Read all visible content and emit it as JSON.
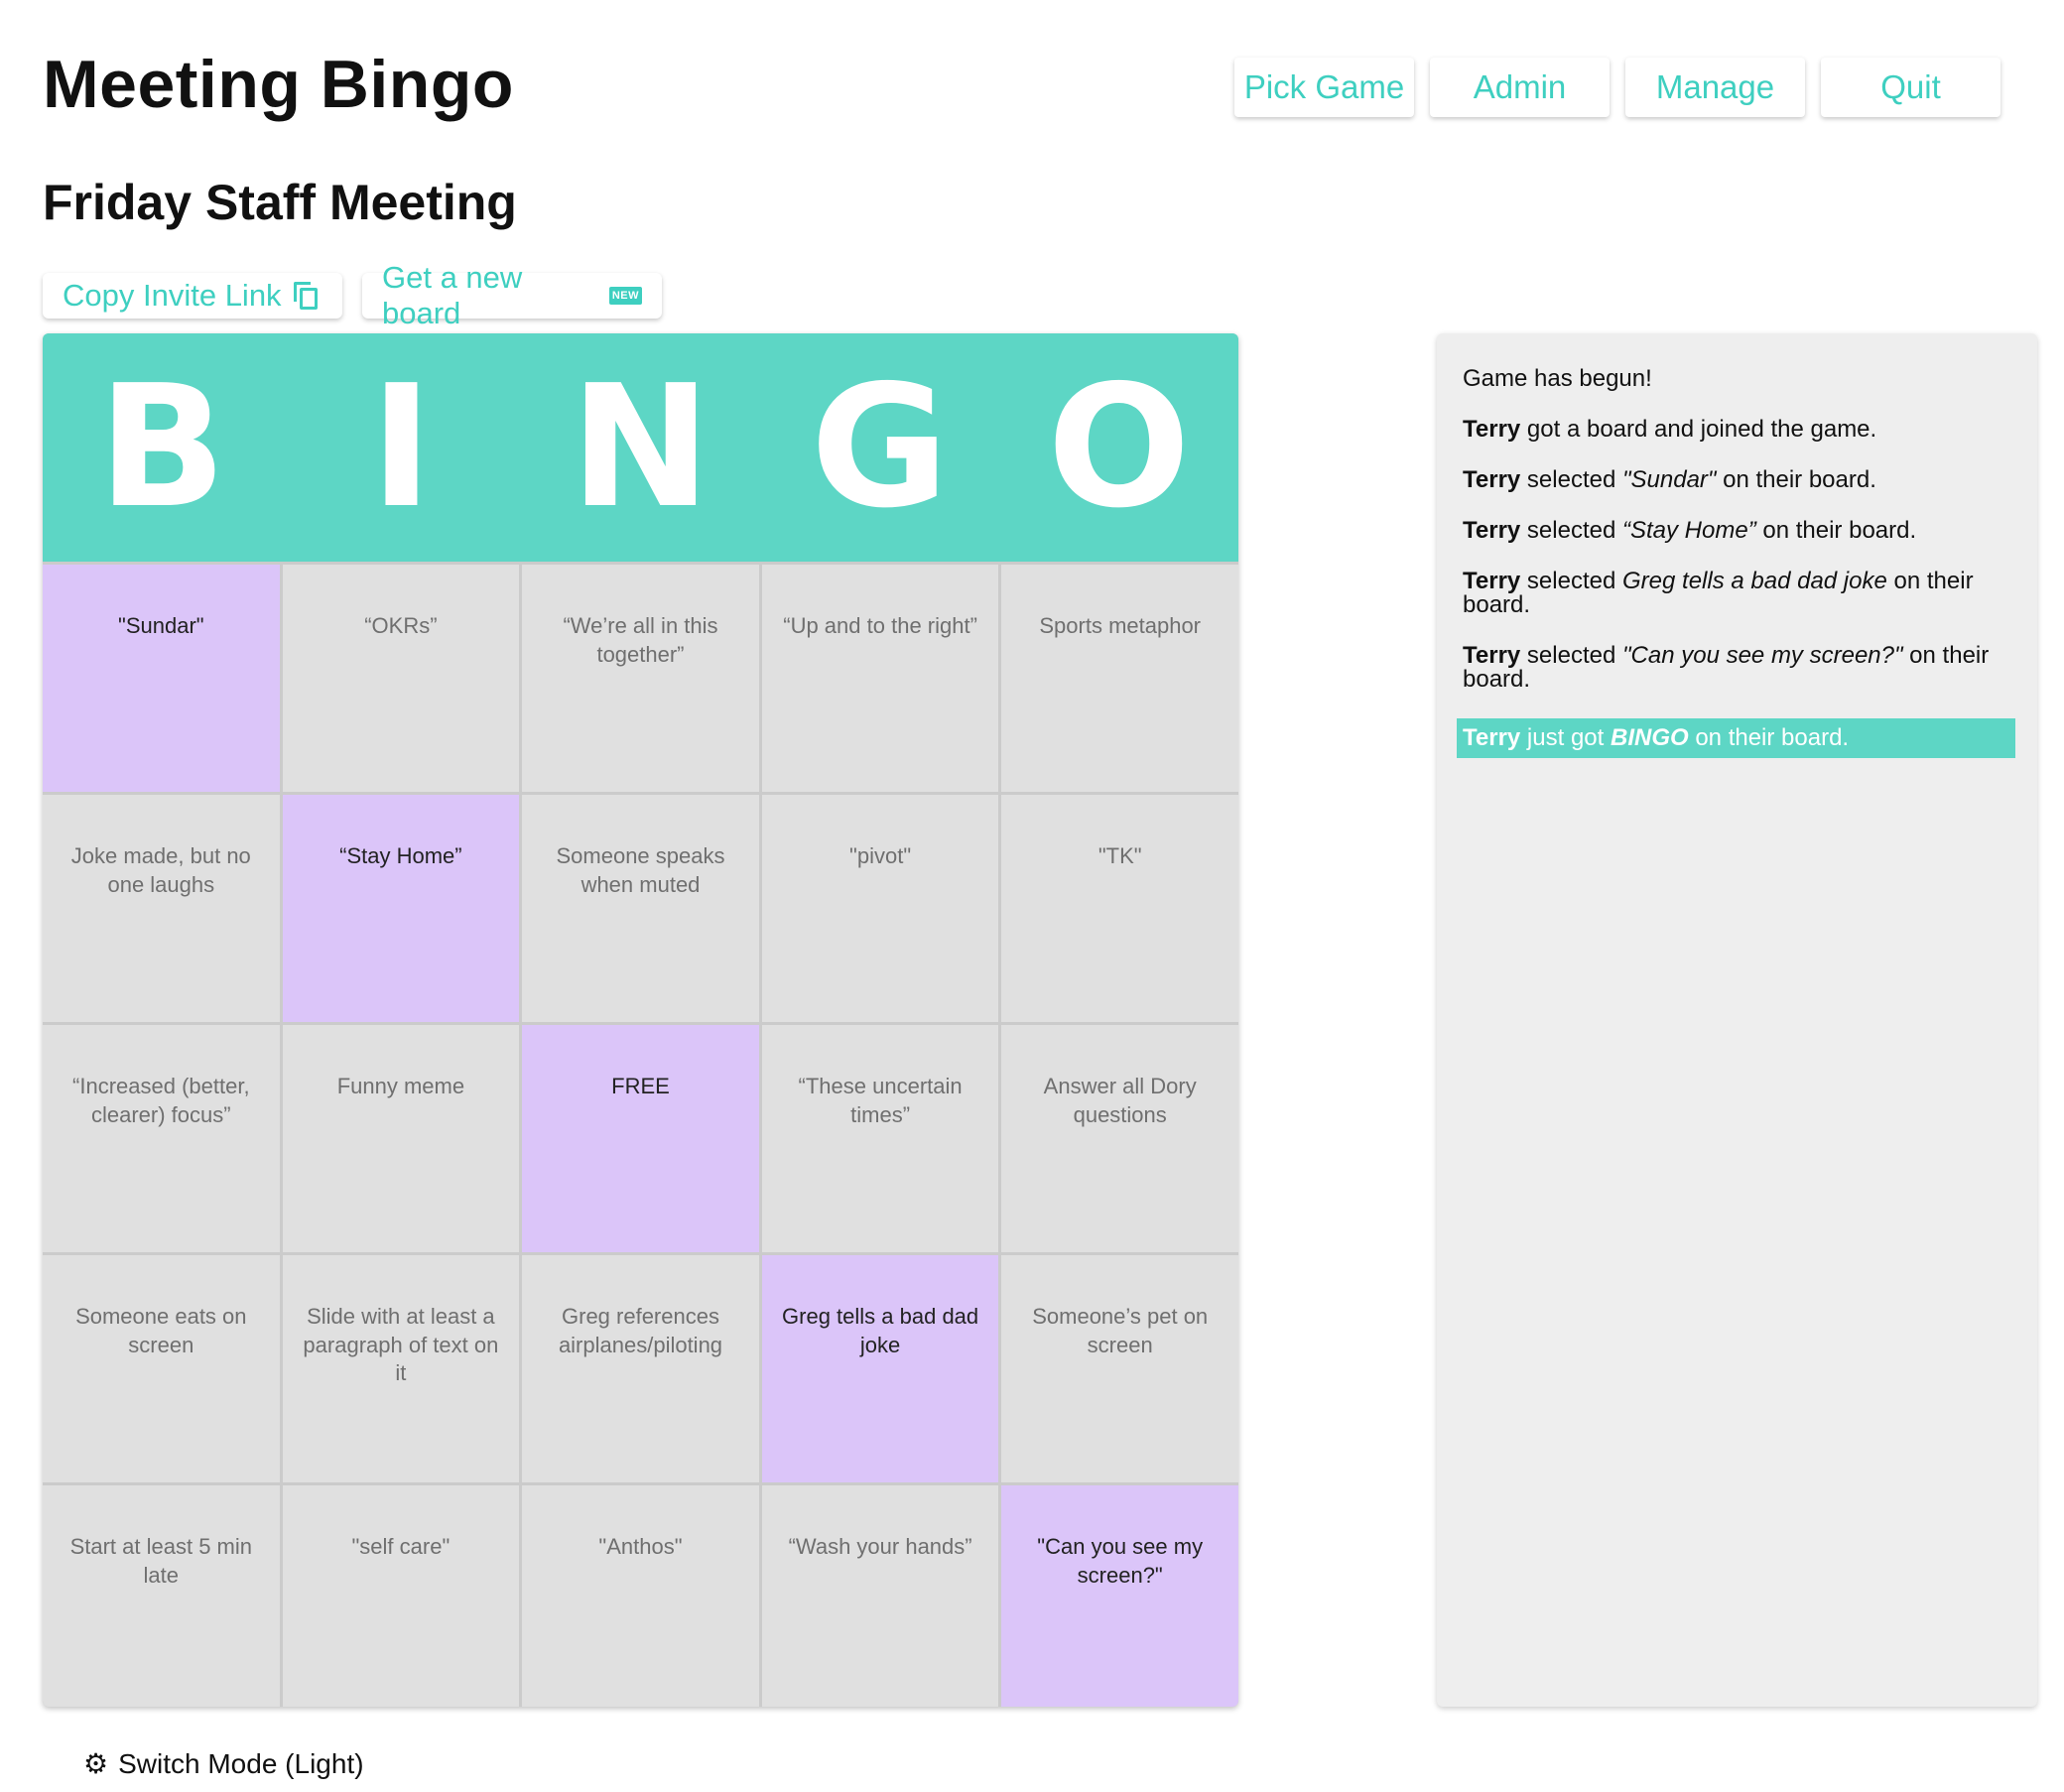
{
  "app": {
    "title": "Meeting Bingo"
  },
  "nav": {
    "pick_game": "Pick Game",
    "admin": "Admin",
    "manage": "Manage",
    "quit": "Quit"
  },
  "game": {
    "title": "Friday Staff Meeting"
  },
  "actions": {
    "copy_invite": "Copy Invite Link",
    "new_board": "Get a new board",
    "new_badge": "NEW"
  },
  "board": {
    "letters": [
      "B",
      "I",
      "N",
      "G",
      "O"
    ],
    "cells": [
      {
        "text": "\"Sundar\"",
        "selected": true
      },
      {
        "text": "“OKRs”",
        "selected": false
      },
      {
        "text": "“We’re all in this together”",
        "selected": false
      },
      {
        "text": "“Up and to the right”",
        "selected": false
      },
      {
        "text": "Sports metaphor",
        "selected": false
      },
      {
        "text": "Joke made, but no one laughs",
        "selected": false
      },
      {
        "text": "“Stay Home”",
        "selected": true
      },
      {
        "text": "Someone speaks when muted",
        "selected": false
      },
      {
        "text": "\"pivot\"",
        "selected": false
      },
      {
        "text": "\"TK\"",
        "selected": false
      },
      {
        "text": "“Increased (better, clearer) focus”",
        "selected": false
      },
      {
        "text": "Funny meme",
        "selected": false
      },
      {
        "text": "FREE",
        "selected": true
      },
      {
        "text": "“These uncertain times”",
        "selected": false
      },
      {
        "text": "Answer all Dory questions",
        "selected": false
      },
      {
        "text": "Someone eats on screen",
        "selected": false
      },
      {
        "text": "Slide with at least a paragraph of text on it",
        "selected": false
      },
      {
        "text": "Greg references airplanes/piloting",
        "selected": false
      },
      {
        "text": "Greg tells a bad dad joke",
        "selected": true
      },
      {
        "text": "Someone’s pet on screen",
        "selected": false
      },
      {
        "text": "Start at least 5 min late",
        "selected": false
      },
      {
        "text": "\"self care\"",
        "selected": false
      },
      {
        "text": "\"Anthos\"",
        "selected": false
      },
      {
        "text": "“Wash your hands”",
        "selected": false
      },
      {
        "text": "\"Can you see my screen?\"",
        "selected": true
      }
    ]
  },
  "log": {
    "begun": "Game has begun!",
    "player": "Terry",
    "joined": " got a board and joined the game.",
    "selected_prefix": " selected ",
    "on_board": " on their board.",
    "on_their": " on their board.",
    "sel1": "\"Sundar\"",
    "sel2": "“Stay Home”",
    "sel3": "Greg tells a bad dad joke",
    "sel4": "\"Can you see my screen?\"",
    "bingo_pre": " just got ",
    "bingo_word": "BINGO",
    "bingo_post": " on their board."
  },
  "footer": {
    "switch_mode": "Switch Mode (Light)",
    "icon": "gear-icon"
  },
  "colors": {
    "accent": "#5dd6c5",
    "selected": "#dbc5f9",
    "cell": "#e0e0e0"
  }
}
